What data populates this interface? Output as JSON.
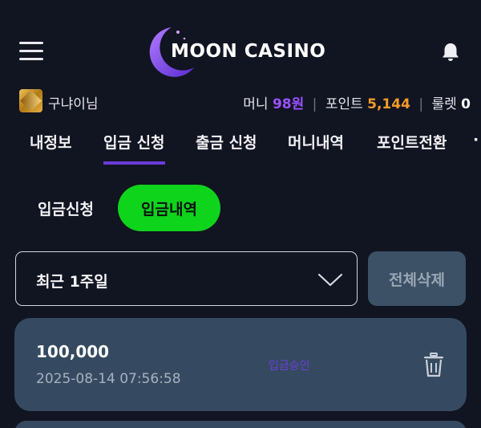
{
  "header": {
    "logo_text": "MOON CASINO",
    "menu_icon": "hamburger-menu-icon",
    "notification_icon": "bell-icon"
  },
  "user": {
    "name": "구냐이님",
    "money_label": "머니",
    "money_value": "98원",
    "point_label": "포인트",
    "point_value": "5,144",
    "roulette_label": "룰렛",
    "roulette_value": "0"
  },
  "tabs": [
    {
      "label": "내정보",
      "active": false
    },
    {
      "label": "입금 신청",
      "active": true
    },
    {
      "label": "출금 신청",
      "active": false
    },
    {
      "label": "머니내역",
      "active": false
    },
    {
      "label": "포인트전환",
      "active": false
    }
  ],
  "subtabs": [
    {
      "label": "입금신청",
      "active": false
    },
    {
      "label": "입금내역",
      "active": true
    }
  ],
  "filter": {
    "period_selected": "최근 1주일",
    "delete_all_label": "전체삭제"
  },
  "records": [
    {
      "amount": "100,000",
      "datetime": "2025-08-14 07:56:58",
      "status": "입금승인"
    }
  ],
  "colors": {
    "background": "#111421",
    "card": "#354a60",
    "accent_purple": "#6b3bd8",
    "money": "#9a52ff",
    "point": "#f39b2a",
    "active_green": "#0fd41c"
  }
}
